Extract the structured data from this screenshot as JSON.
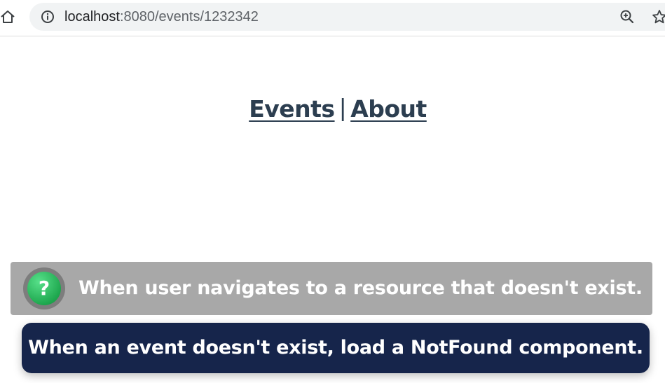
{
  "browser": {
    "url_host": "localhost",
    "url_path": ":8080/events/1232342",
    "icons": [
      "home-icon",
      "info-icon",
      "zoom-icon",
      "star-icon"
    ]
  },
  "nav": {
    "events_label": "Events",
    "separator": "|",
    "about_label": "About"
  },
  "overlay": {
    "question_mark": "?",
    "question_text": "When user navigates to a resource that doesn't exist.",
    "caption_text": "When an event doesn't exist, load a NotFound component."
  },
  "colors": {
    "nav_text": "#2c3e50",
    "question_box": "#a8a8a8",
    "question_icon": "#1fa84f",
    "caption_box": "#16254b"
  }
}
